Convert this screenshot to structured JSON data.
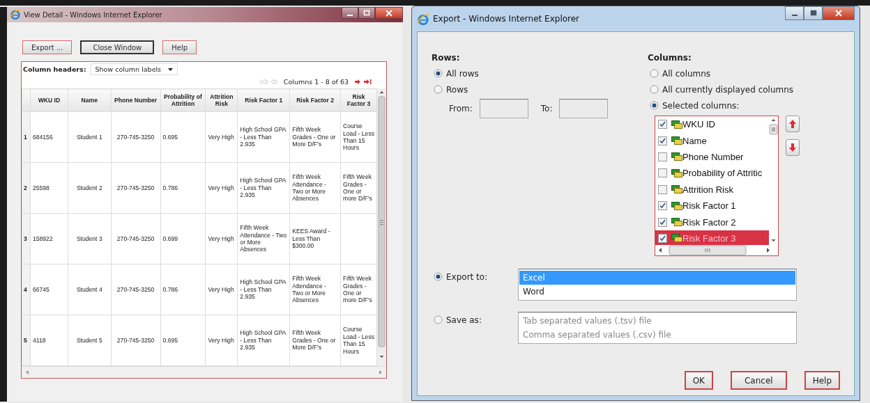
{
  "detail_window": {
    "title": "View Detail - Windows Internet Explorer",
    "buttons": [
      {
        "label": "Export ...",
        "focused": false
      },
      {
        "label": "Close Window",
        "focused": true
      },
      {
        "label": "Help",
        "focused": false
      }
    ],
    "column_headers_label": "Column headers:",
    "column_headers_select": "Show column labels",
    "paging": "Columns 1 - 8 of 63",
    "table": {
      "columns": [
        "WKU ID",
        "Name",
        "Phone Number",
        "Probability of Attrition",
        "Attrition Risk",
        "Risk Factor 1",
        "Risk Factor 2",
        "Risk Factor 3"
      ],
      "rows": [
        {
          "index": "1",
          "cells": [
            "684156",
            "Student 1",
            "270-745-3250",
            "0.695",
            "Very High",
            "High School GPA - Less Than 2.935",
            "Fifth Week Grades - One or More D/F's",
            "Course Load - Less Than 15 Hours"
          ]
        },
        {
          "index": "2",
          "cells": [
            "25598",
            "Student 2",
            "270-745-3250",
            "0.786",
            "Very High",
            "High School GPA - Less Than 2.935",
            "Fifth Week Attendance - Two or More Absences",
            "Fifth Week Grades - One or more D/F's"
          ]
        },
        {
          "index": "3",
          "cells": [
            "158922",
            "Student 3",
            "270-745-3250",
            "0.699",
            "Very High",
            "Fifth Week Attendance - Two or More Absences",
            "KEES Award - Less Than $300.00",
            ""
          ]
        },
        {
          "index": "4",
          "cells": [
            "66745",
            "Student 4",
            "270-745-3250",
            "0.786",
            "Very High",
            "High School GPA - Less Than 2.935",
            "Fifth Week Attendance - Two or More Absences",
            "Fifth Week Grades - One or more D/F's"
          ]
        },
        {
          "index": "5",
          "cells": [
            "4118",
            "Student 5",
            "270-745-3250",
            "0.695",
            "Very High",
            "High School GPA - Less Than 2.935",
            "Fifth Week Grades - One or More D/F's",
            "Course Load - Less Than 15 Hours"
          ]
        }
      ]
    }
  },
  "export_window": {
    "title": "Export - Windows Internet Explorer",
    "rows_label": "Rows:",
    "row_options": [
      {
        "label": "All rows",
        "selected": true
      },
      {
        "label": "Rows",
        "selected": false
      }
    ],
    "from_label": "From:",
    "to_label": "To:",
    "columns_label": "Columns:",
    "column_options": [
      {
        "label": "All columns",
        "selected": false
      },
      {
        "label": "All currently displayed columns",
        "selected": false
      },
      {
        "label": "Selected columns:",
        "selected": true
      }
    ],
    "column_list": [
      {
        "label": "WKU ID",
        "checked": true,
        "selected": false
      },
      {
        "label": "Name",
        "checked": true,
        "selected": false
      },
      {
        "label": "Phone Number",
        "checked": false,
        "selected": false
      },
      {
        "label": "Probability of Attritic",
        "checked": false,
        "selected": false
      },
      {
        "label": "Attrition Risk",
        "checked": false,
        "selected": false
      },
      {
        "label": "Risk Factor 1",
        "checked": true,
        "selected": false
      },
      {
        "label": "Risk Factor 2",
        "checked": true,
        "selected": false
      },
      {
        "label": "Risk Factor 3",
        "checked": true,
        "selected": true
      }
    ],
    "export_to": {
      "label": "Export to:",
      "selected": true,
      "formats": [
        {
          "label": "Excel",
          "selected": true
        },
        {
          "label": "Word",
          "selected": false
        }
      ]
    },
    "save_as": {
      "label": "Save as:",
      "selected": false,
      "formats": [
        {
          "label": "Tab separated values (.tsv) file",
          "selected": false
        },
        {
          "label": "Comma separated values (.csv) file",
          "selected": false
        }
      ]
    },
    "buttons": [
      {
        "label": "OK"
      },
      {
        "label": "Cancel"
      },
      {
        "label": "Help"
      }
    ]
  }
}
